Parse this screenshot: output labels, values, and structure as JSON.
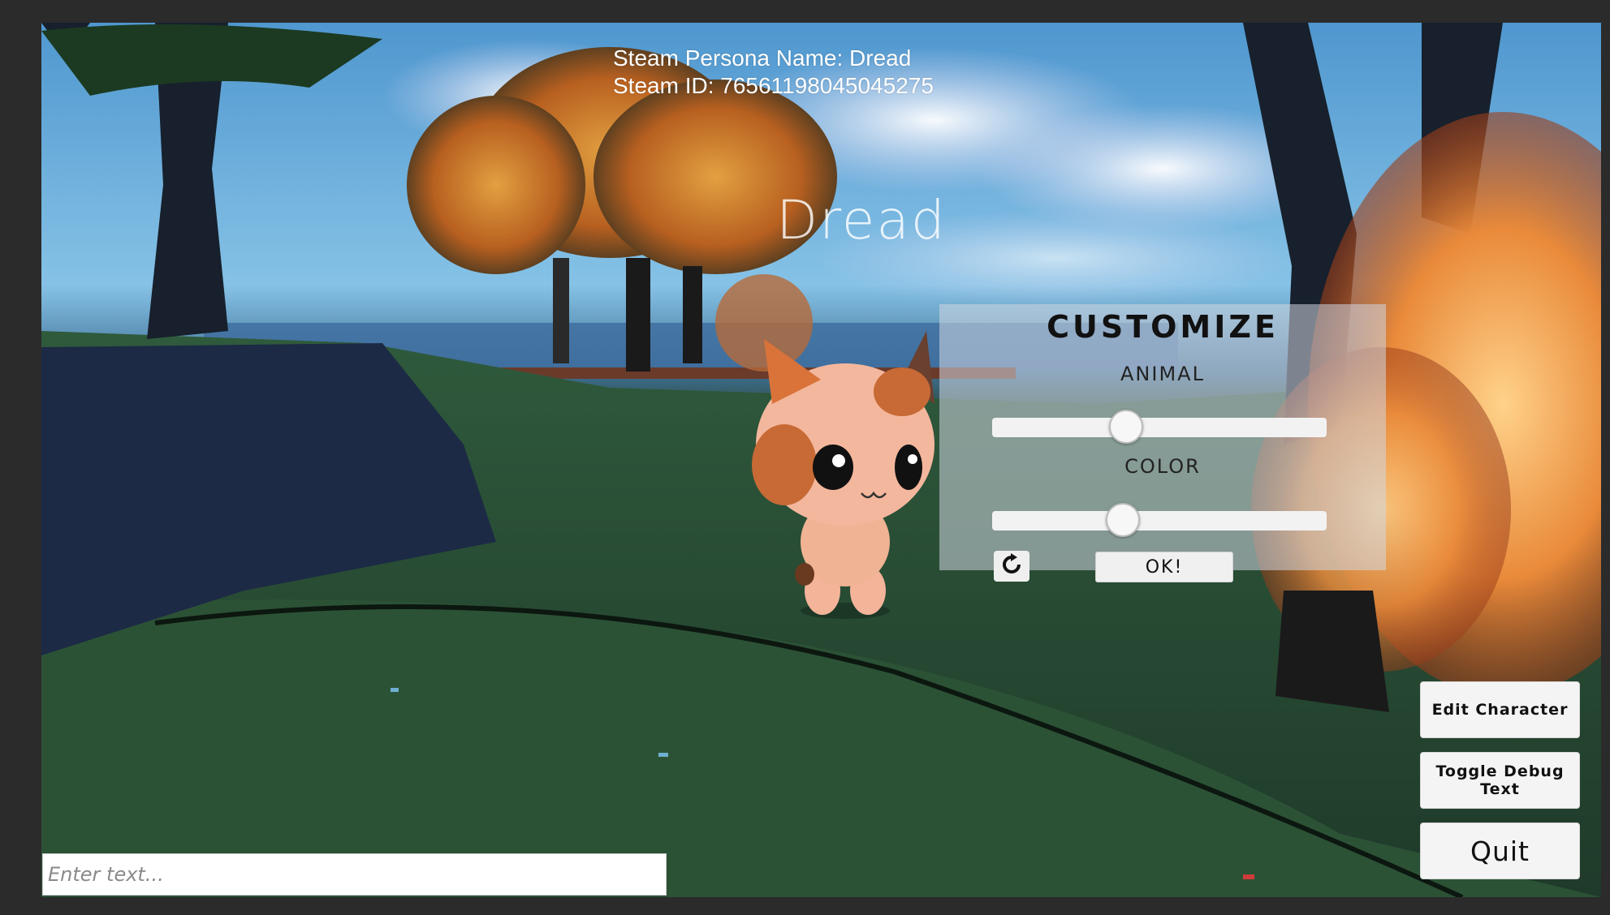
{
  "debug": {
    "persona_name_line": "Steam Persona Name: Dread",
    "steam_id_line": "Steam ID: 76561198045045275"
  },
  "player": {
    "nameplate": "Dread"
  },
  "customize": {
    "title": "CUSTOMIZE",
    "animal_label": "ANIMAL",
    "animal_value": 0.4,
    "color_label": "COLOR",
    "color_value": 0.39,
    "ok_label": "OK!",
    "refresh_icon": "refresh-icon"
  },
  "buttons": {
    "edit_character": "Edit Character",
    "toggle_debug": "Toggle Debug Text",
    "quit": "Quit"
  },
  "chat": {
    "placeholder": "Enter text..."
  }
}
